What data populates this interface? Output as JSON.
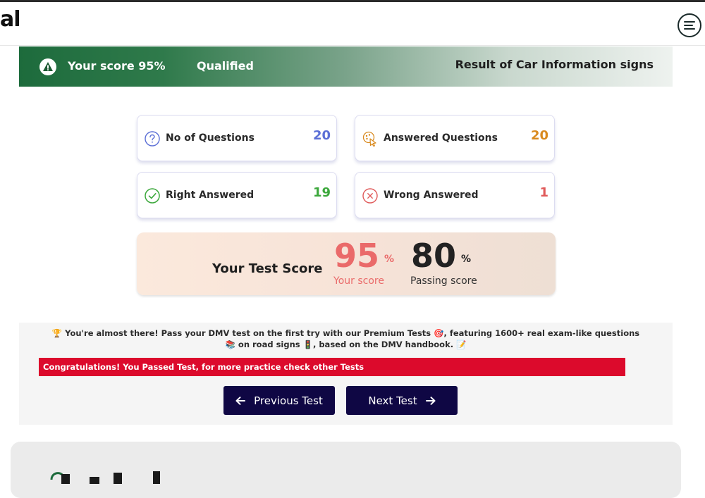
{
  "header": {
    "logo_fragment": "al",
    "menu_icon": "menu-lines-icon"
  },
  "banner": {
    "score_text": "Your score 95%",
    "status": "Qualified",
    "result_title": "Result of Car Information signs",
    "icon": "alert-triangle-icon"
  },
  "stats": [
    {
      "label": "No of Questions",
      "value": "20",
      "icon": "question-circle-icon",
      "color": "#5b6fd6"
    },
    {
      "label": "Answered Questions",
      "value": "20",
      "icon": "answered-pointer-icon",
      "color": "#d98a1f"
    },
    {
      "label": "Right Answered",
      "value": "19",
      "icon": "check-circle-icon",
      "color": "#3ca83c"
    },
    {
      "label": "Wrong Answered",
      "value": "1",
      "icon": "x-circle-icon",
      "color": "#e05a5a"
    }
  ],
  "score_panel": {
    "title": "Your Test Score",
    "your_score": "95",
    "your_score_pct": "%",
    "your_score_label": "Your score",
    "passing_score": "80",
    "passing_score_pct": "%",
    "passing_score_label": "Passing score",
    "your_score_color": "#ea6a6a",
    "passing_color": "#222222"
  },
  "promo": {
    "text": "🏆 You're almost there! Pass your DMV test on the first try with our Premium Tests 🎯, featuring 1600+ real exam-like questions 📚 on road signs 🚦, based on the DMV handbook. 📝",
    "congrats": "Congratulations! You Passed Test, for more practice check other Tests",
    "prev_label": "Previous Test",
    "next_label": "Next Test"
  },
  "colors": {
    "brand_green": "#1d6b3c",
    "nav_button": "#0f0744",
    "alert_red": "#dc0a2c"
  }
}
